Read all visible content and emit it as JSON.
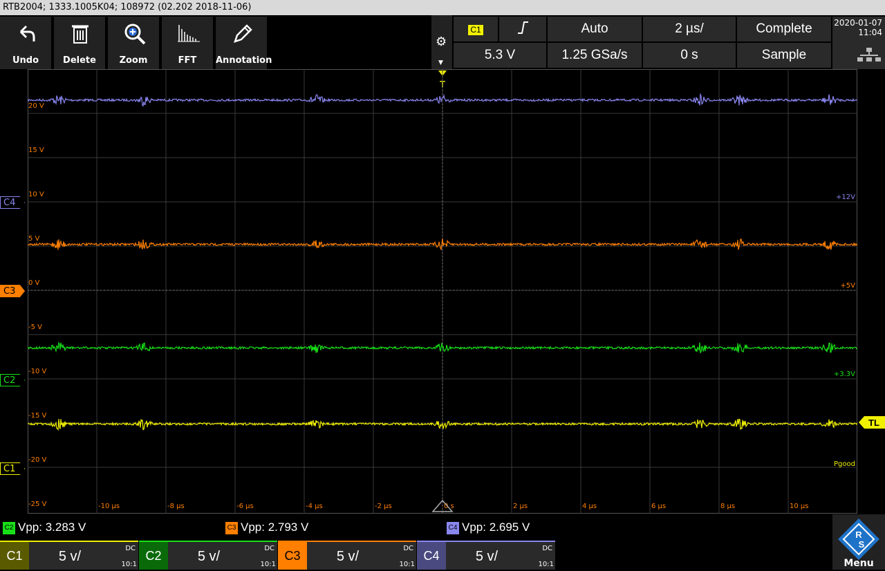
{
  "title": "RTB2004; 1333.1005K04; 108972 (02.202 2018-11-06)",
  "toolbar": {
    "buttons": [
      {
        "label": "Undo",
        "icon": "undo-icon"
      },
      {
        "label": "Delete",
        "icon": "trash-icon"
      },
      {
        "label": "Zoom",
        "icon": "zoom-icon"
      },
      {
        "label": "FFT",
        "icon": "fft-icon"
      },
      {
        "label": "Annotation",
        "icon": "pencil-icon"
      }
    ]
  },
  "trigger": {
    "source": "C1",
    "slope_icon": "rising-edge-icon",
    "mode": "Auto",
    "level": "5.3 V",
    "sample_rate": "1.25 GSa/s",
    "timebase": "2 µs/",
    "position": "0 s",
    "acq_state": "Complete",
    "acq_mode": "Sample"
  },
  "datetime": {
    "date": "2020-01-07",
    "time": "11:04"
  },
  "grid": {
    "y_labels": [
      "20 V",
      "15 V",
      "10 V",
      "5 V",
      "0 V",
      "-5 V",
      "-10 V",
      "-15 V",
      "-20 V",
      "-25 V"
    ],
    "x_labels": [
      "-10 µs",
      "-8 µs",
      "-6 µs",
      "-4 µs",
      "-2 µs",
      "0 s",
      "2 µs",
      "4 µs",
      "6 µs",
      "8 µs",
      "10 µs"
    ]
  },
  "channel_markers": [
    {
      "name": "C4",
      "color": "#8a86f0"
    },
    {
      "name": "C3",
      "color": "#ff7f00"
    },
    {
      "name": "C2",
      "color": "#18e018"
    },
    {
      "name": "C1",
      "color": "#f0f000"
    }
  ],
  "trace_labels": [
    {
      "text": "+12V",
      "color": "#8a86f0"
    },
    {
      "text": "+5V",
      "color": "#ff7f00"
    },
    {
      "text": "+3.3V",
      "color": "#18e018"
    },
    {
      "text": "Pgood",
      "color": "#f0f000"
    }
  ],
  "trigger_marker": "T",
  "trigger_level_marker": "TL",
  "measurements": [
    {
      "ch": "C2",
      "text": "Vpp: 3.283 V",
      "color": "#18e018"
    },
    {
      "ch": "C3",
      "text": "Vpp: 2.793 V",
      "color": "#ff7f00"
    },
    {
      "ch": "C4",
      "text": "Vpp: 2.695 V",
      "color": "#8a86f0"
    }
  ],
  "channels": [
    {
      "name": "C1",
      "scale": "5 v/",
      "coupling": "DC",
      "probe": "10:1",
      "color": "#f0f000",
      "bg": "#5a5a00"
    },
    {
      "name": "C2",
      "scale": "5 v/",
      "coupling": "DC",
      "probe": "10:1",
      "color": "#18e018",
      "bg": "#0a6a0a"
    },
    {
      "name": "C3",
      "scale": "5 v/",
      "coupling": "DC",
      "probe": "10:1",
      "color": "#ff7f00",
      "bg": "#ff7f00"
    },
    {
      "name": "C4",
      "scale": "5 v/",
      "coupling": "DC",
      "probe": "10:1",
      "color": "#8a86f0",
      "bg": "#4a4a80"
    }
  ],
  "menu_label": "Menu",
  "waveforms": [
    {
      "channel": "C4",
      "level_v": 21.5,
      "color": "#8a86f0"
    },
    {
      "channel": "C3",
      "level_v": 5.2,
      "color": "#ff7f00"
    },
    {
      "channel": "C2",
      "level_v": -6.5,
      "color": "#18e018"
    },
    {
      "channel": "C1",
      "level_v": -15.1,
      "color": "#f0f000"
    }
  ]
}
